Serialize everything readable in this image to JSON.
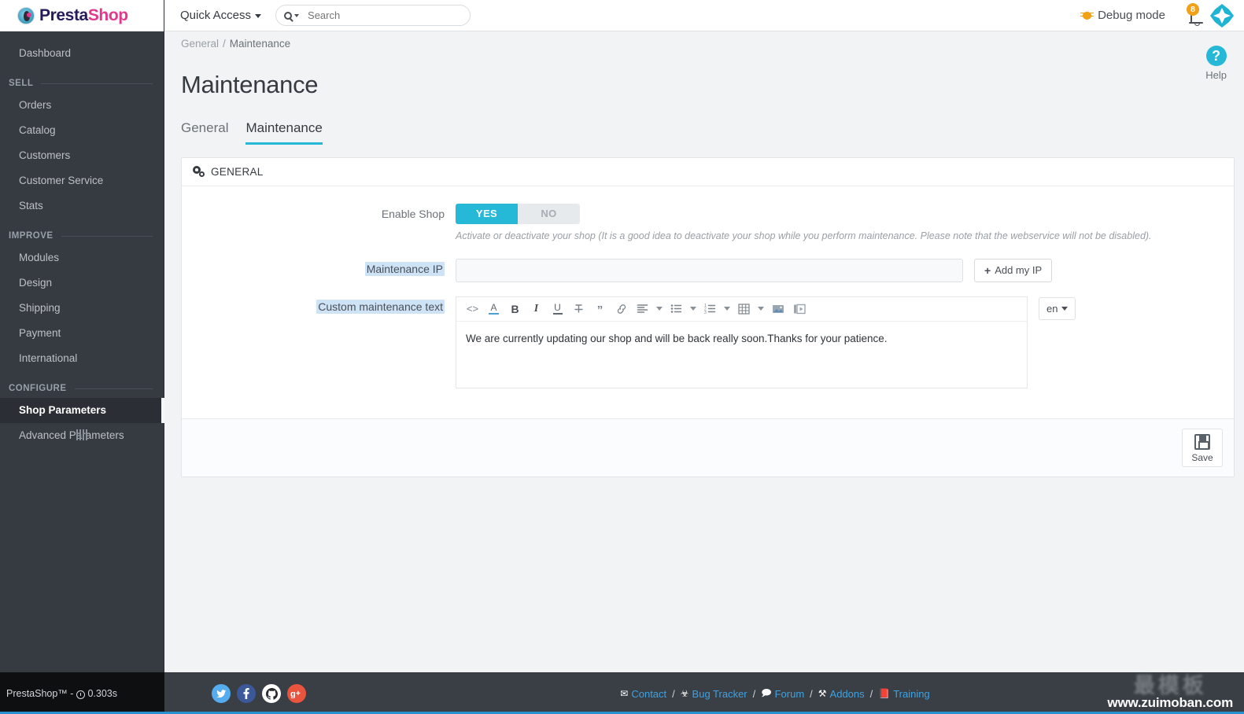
{
  "brand": {
    "logo_presta": "Presta",
    "logo_shop": "Shop",
    "logo_icon": "prestashop-logo-icon"
  },
  "topbar": {
    "quick_access": "Quick Access",
    "search_placeholder": "Search",
    "search_value": "",
    "search_icon": "search-icon",
    "debug_mode": "Debug mode",
    "debug_icon": "bug-icon",
    "bell_icon": "bell-icon",
    "notification_count": "8",
    "avatar_icon": "employee-avatar-icon",
    "accent_color": "#25b9d7",
    "badge_color": "#f0a117"
  },
  "sidebar": {
    "top_items": [
      {
        "label": "Dashboard",
        "name": "dashboard"
      }
    ],
    "sections": [
      {
        "title": "SELL",
        "items": [
          {
            "label": "Orders",
            "name": "orders"
          },
          {
            "label": "Catalog",
            "name": "catalog"
          },
          {
            "label": "Customers",
            "name": "customers"
          },
          {
            "label": "Customer Service",
            "name": "customer-service"
          },
          {
            "label": "Stats",
            "name": "stats"
          }
        ]
      },
      {
        "title": "IMPROVE",
        "items": [
          {
            "label": "Modules",
            "name": "modules"
          },
          {
            "label": "Design",
            "name": "design"
          },
          {
            "label": "Shipping",
            "name": "shipping"
          },
          {
            "label": "Payment",
            "name": "payment"
          },
          {
            "label": "International",
            "name": "international"
          }
        ]
      },
      {
        "title": "CONFIGURE",
        "items": [
          {
            "label": "Shop Parameters",
            "name": "shop-parameters",
            "active": true
          },
          {
            "label": "Advanced Parameters",
            "name": "advanced-parameters"
          }
        ]
      }
    ],
    "collapse_icon": "collapse-sidebar-icon",
    "footer_text": "PrestaShop™ -",
    "footer_time": "0.303s",
    "footer_clock_icon": "clock-icon"
  },
  "page": {
    "breadcrumb_parent": "General",
    "breadcrumb_sep": "/",
    "breadcrumb_current": "Maintenance",
    "title": "Maintenance",
    "help_label": "Help",
    "help_icon": "question-mark-icon",
    "tabs": [
      {
        "label": "General",
        "name": "general",
        "active": false
      },
      {
        "label": "Maintenance",
        "name": "maintenance",
        "active": true
      }
    ]
  },
  "panel": {
    "header": "GENERAL",
    "header_icon": "gears-icon",
    "enable_shop": {
      "label": "Enable Shop",
      "yes": "YES",
      "no": "NO",
      "value": "YES",
      "hint": "Activate or deactivate your shop (It is a good idea to deactivate your shop while you perform maintenance. Please note that the webservice will not be disabled)."
    },
    "maintenance_ip": {
      "label": "Maintenance IP",
      "value": "",
      "add_button": "Add my IP",
      "add_icon": "plus-icon"
    },
    "custom_text": {
      "label": "Custom maintenance text",
      "content": "We are currently updating our shop and will be back really soon.Thanks for your patience.",
      "language": "en",
      "toolbar": [
        {
          "name": "source-code-icon",
          "glyph": "<>",
          "caret": false
        },
        {
          "name": "font-color-icon",
          "glyph": "A",
          "caret": false
        },
        {
          "name": "bold-icon",
          "glyph": "B",
          "caret": false
        },
        {
          "name": "italic-icon",
          "glyph": "I",
          "caret": false
        },
        {
          "name": "underline-icon",
          "glyph": "U",
          "caret": false
        },
        {
          "name": "strikethrough-icon",
          "glyph": "S",
          "caret": false
        },
        {
          "name": "blockquote-icon",
          "glyph": "\"",
          "caret": false
        },
        {
          "name": "link-icon",
          "glyph": "link",
          "caret": false
        },
        {
          "name": "align-icon",
          "glyph": "align",
          "caret": true
        },
        {
          "name": "bullet-list-icon",
          "glyph": "ul",
          "caret": true
        },
        {
          "name": "numbered-list-icon",
          "glyph": "ol",
          "caret": true
        },
        {
          "name": "table-icon",
          "glyph": "table",
          "caret": true
        },
        {
          "name": "image-icon",
          "glyph": "image",
          "caret": false
        },
        {
          "name": "video-icon",
          "glyph": "video",
          "caret": false
        }
      ]
    },
    "save_label": "Save",
    "save_icon": "floppy-disk-icon"
  },
  "footer": {
    "social": [
      {
        "name": "twitter-icon",
        "glyph": "t",
        "color": "#55acee"
      },
      {
        "name": "facebook-icon",
        "glyph": "f",
        "color": "#3b5998"
      },
      {
        "name": "github-icon",
        "glyph": "g",
        "color": "#ffffff"
      },
      {
        "name": "google-plus-icon",
        "glyph": "g+",
        "color": "#e9543f"
      }
    ],
    "links": [
      {
        "label": "Contact",
        "icon": "envelope-icon",
        "glyph": "✉"
      },
      {
        "label": "Bug Tracker",
        "icon": "bug-icon",
        "glyph": "☣"
      },
      {
        "label": "Forum",
        "icon": "comment-icon",
        "glyph": "὞9"
      },
      {
        "label": "Addons",
        "icon": "puzzle-icon",
        "glyph": "⚒"
      },
      {
        "label": "Training",
        "icon": "book-icon",
        "glyph": "Ὅ5"
      }
    ],
    "separator": "/",
    "watermark_cjk": "最模板",
    "watermark_url": "www.zuimoban.com"
  }
}
